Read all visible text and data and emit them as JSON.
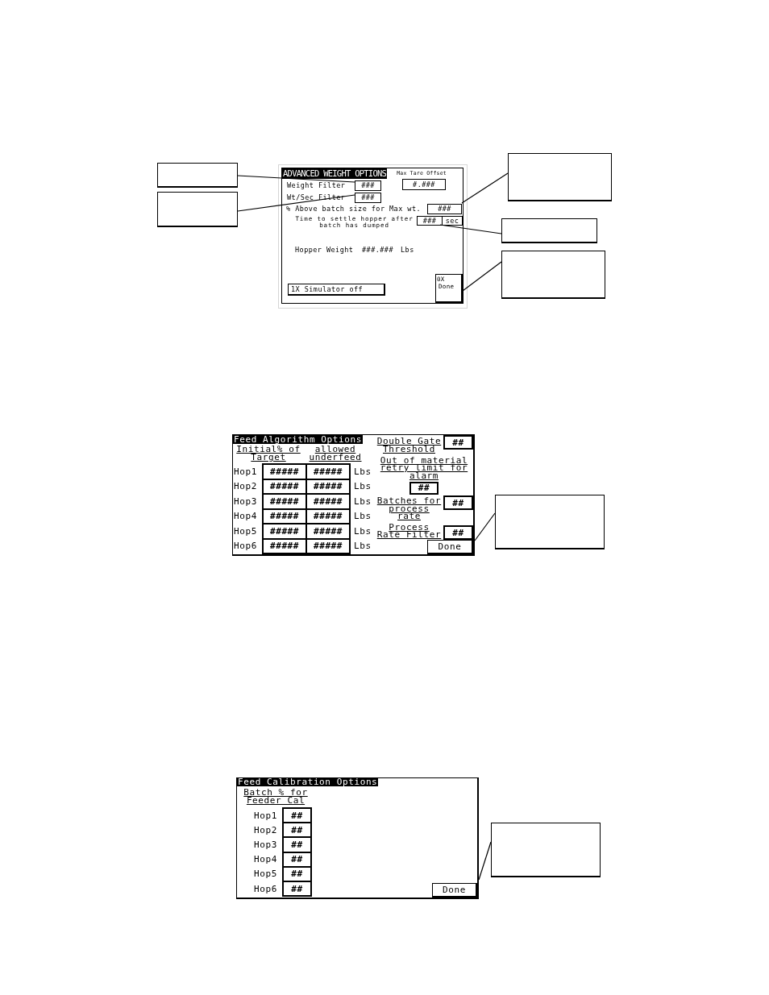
{
  "advanced_weight_options": {
    "title": "ADVANCED WEIGHT OPTIONS",
    "max_tare_offset": {
      "label": "Max Tare Offset",
      "value": "#.###"
    },
    "weight_filter": {
      "label": "Weight Filter",
      "value": "###"
    },
    "wt_sec_filter": {
      "label": "Wt/Sec Filter",
      "value": "###"
    },
    "above_batch_size": {
      "label": "% Above batch size for Max wt.",
      "value": "###"
    },
    "settle_time": {
      "label": "Time to settle hopper after\nbatch has dumped",
      "value": "###",
      "unit": "sec"
    },
    "hopper_weight": {
      "label": "Hopper Weight",
      "value": "###.###",
      "unit": "Lbs"
    },
    "simulator_button": "1X Simulator off",
    "done_button": {
      "prefix": "0X",
      "label": "Done"
    }
  },
  "feed_algorithm_options": {
    "title": "Feed Algorithm Options",
    "column_headings": [
      "Initial% of\nTarget",
      "allowed\nunderfeed"
    ],
    "hoppers": [
      {
        "name": "Hop1",
        "initial_percent": "#####",
        "allowed_underfeed": "#####",
        "unit": "Lbs"
      },
      {
        "name": "Hop2",
        "initial_percent": "#####",
        "allowed_underfeed": "#####",
        "unit": "Lbs"
      },
      {
        "name": "Hop3",
        "initial_percent": "#####",
        "allowed_underfeed": "#####",
        "unit": "Lbs"
      },
      {
        "name": "Hop4",
        "initial_percent": "#####",
        "allowed_underfeed": "#####",
        "unit": "Lbs"
      },
      {
        "name": "Hop5",
        "initial_percent": "#####",
        "allowed_underfeed": "#####",
        "unit": "Lbs"
      },
      {
        "name": "Hop6",
        "initial_percent": "#####",
        "allowed_underfeed": "#####",
        "unit": "Lbs"
      }
    ],
    "double_gate_threshold": {
      "label": "Double Gate\nThreshold",
      "value": "##"
    },
    "retry_limit": {
      "label": "Out of material\nretry limit for\nalarm",
      "value": "##"
    },
    "process_rate_batches": {
      "label": "Batches for\nprocess\nrate",
      "value": "##"
    },
    "process_rate_filter": {
      "label": "Process\nRate Filter",
      "value": "##"
    },
    "done_button": "Done"
  },
  "feed_calibration_options": {
    "title": "Feed Calibration Options",
    "column_heading": "Batch % for\nFeeder Cal",
    "hoppers": [
      {
        "name": "Hop1",
        "batch_percent": "##"
      },
      {
        "name": "Hop2",
        "batch_percent": "##"
      },
      {
        "name": "Hop3",
        "batch_percent": "##"
      },
      {
        "name": "Hop4",
        "batch_percent": "##"
      },
      {
        "name": "Hop5",
        "batch_percent": "##"
      },
      {
        "name": "Hop6",
        "batch_percent": "##"
      }
    ],
    "done_button": "Done"
  }
}
